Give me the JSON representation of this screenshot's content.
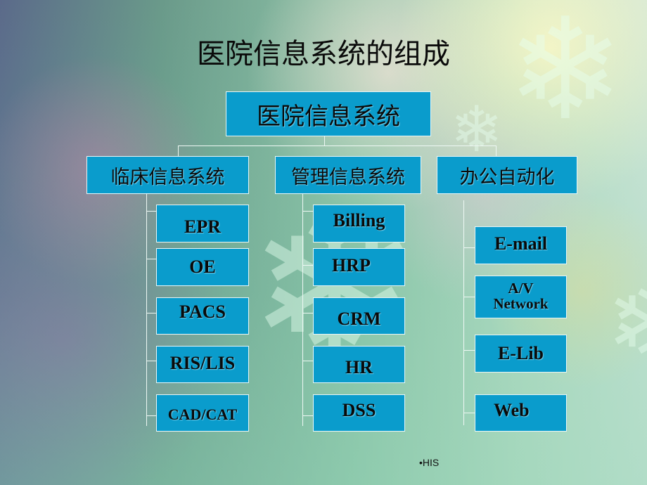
{
  "slide": {
    "title": "医院信息系统的组成",
    "footer": "•HIS"
  },
  "tree": {
    "root": "医院信息系统",
    "branches": [
      {
        "label": "临床信息系统",
        "children": [
          "EPR",
          "OE",
          "PACS",
          "RIS/LIS",
          "CAD/CAT"
        ]
      },
      {
        "label": "管理信息系统",
        "children": [
          "Billing",
          "HRP",
          "CRM",
          "HR",
          "DSS"
        ]
      },
      {
        "label": "办公自动化",
        "children": [
          "E-mail",
          "A/V Network",
          "E-Lib",
          "Web"
        ]
      }
    ]
  },
  "colors": {
    "box_fill": "#0a9ccc",
    "box_border": "#e8f6f8",
    "connector": "#eef8f4"
  }
}
